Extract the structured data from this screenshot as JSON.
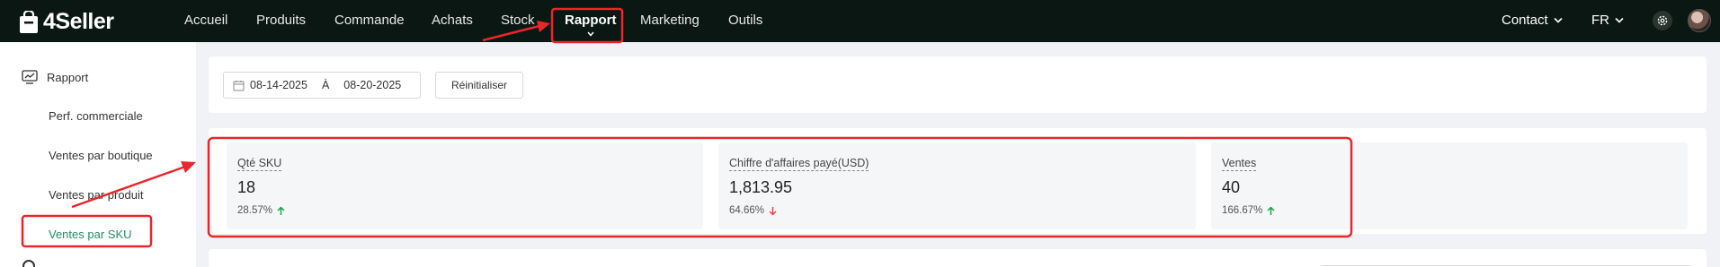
{
  "app": {
    "brand": "4Seller"
  },
  "nav": {
    "items": [
      {
        "label": "Accueil"
      },
      {
        "label": "Produits"
      },
      {
        "label": "Commande"
      },
      {
        "label": "Achats"
      },
      {
        "label": "Stock"
      },
      {
        "label": "Rapport",
        "active": true
      },
      {
        "label": "Marketing"
      },
      {
        "label": "Outils"
      }
    ],
    "contact": "Contact",
    "language": "FR"
  },
  "sidebar": {
    "section": "Rapport",
    "items": [
      {
        "label": "Perf. commerciale"
      },
      {
        "label": "Ventes par boutique"
      },
      {
        "label": "Ventes par produit"
      },
      {
        "label": "Ventes par SKU",
        "active": true
      }
    ]
  },
  "filter": {
    "start_date": "08-14-2025",
    "separator": "À",
    "end_date": "08-20-2025",
    "reset_label": "Réinitialiser"
  },
  "stats": [
    {
      "label": "Qté SKU",
      "value": "18",
      "change": "28.57%",
      "trend": "up"
    },
    {
      "label": "Chiffre d'affaires payé(USD)",
      "value": "1,813.95",
      "change": "64.66%",
      "trend": "down"
    },
    {
      "label": "Ventes",
      "value": "40",
      "change": "166.67%",
      "trend": "up"
    }
  ],
  "colors": {
    "topbar_bg": "#0b1712",
    "accent_green": "#1f8f63",
    "up": "#1aa34a",
    "down": "#e5484d",
    "annotation_red": "#e8262b"
  },
  "icons": {
    "logo": "shopping-bag-icon",
    "sidebar_section": "chart-line-icon",
    "date": "calendar-icon",
    "settings": "gear-icon",
    "trend_up": "arrow-up-icon",
    "trend_down": "arrow-down-icon"
  }
}
